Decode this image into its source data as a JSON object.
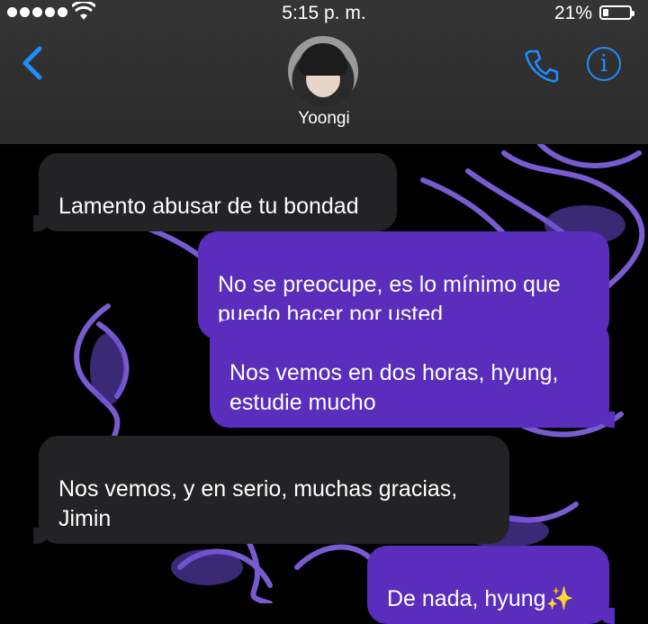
{
  "status_bar": {
    "time": "5:15 p. m.",
    "battery": "21%"
  },
  "header": {
    "contact_name": "Yoongi",
    "icons": [
      "back-chevron-icon",
      "phone-icon",
      "info-icon"
    ],
    "accent_color": "#1f8cff"
  },
  "messages": [
    {
      "direction": "incoming",
      "text": "Lamento abusar de tu bondad"
    },
    {
      "direction": "outgoing",
      "text": "No se preocupe, es lo mínimo que puedo hacer por usted"
    },
    {
      "direction": "outgoing",
      "text": "Nos vemos en dos horas, hyung, estudie mucho"
    },
    {
      "direction": "incoming",
      "text": "Nos vemos, y en serio, muchas gracias, Jimin"
    },
    {
      "direction": "outgoing",
      "text": "De nada, hyung✨"
    }
  ],
  "colors": {
    "incoming_bubble": "#232326",
    "outgoing_bubble": "#5a2dbd",
    "wallpaper_accent": "#8d6cf5"
  }
}
